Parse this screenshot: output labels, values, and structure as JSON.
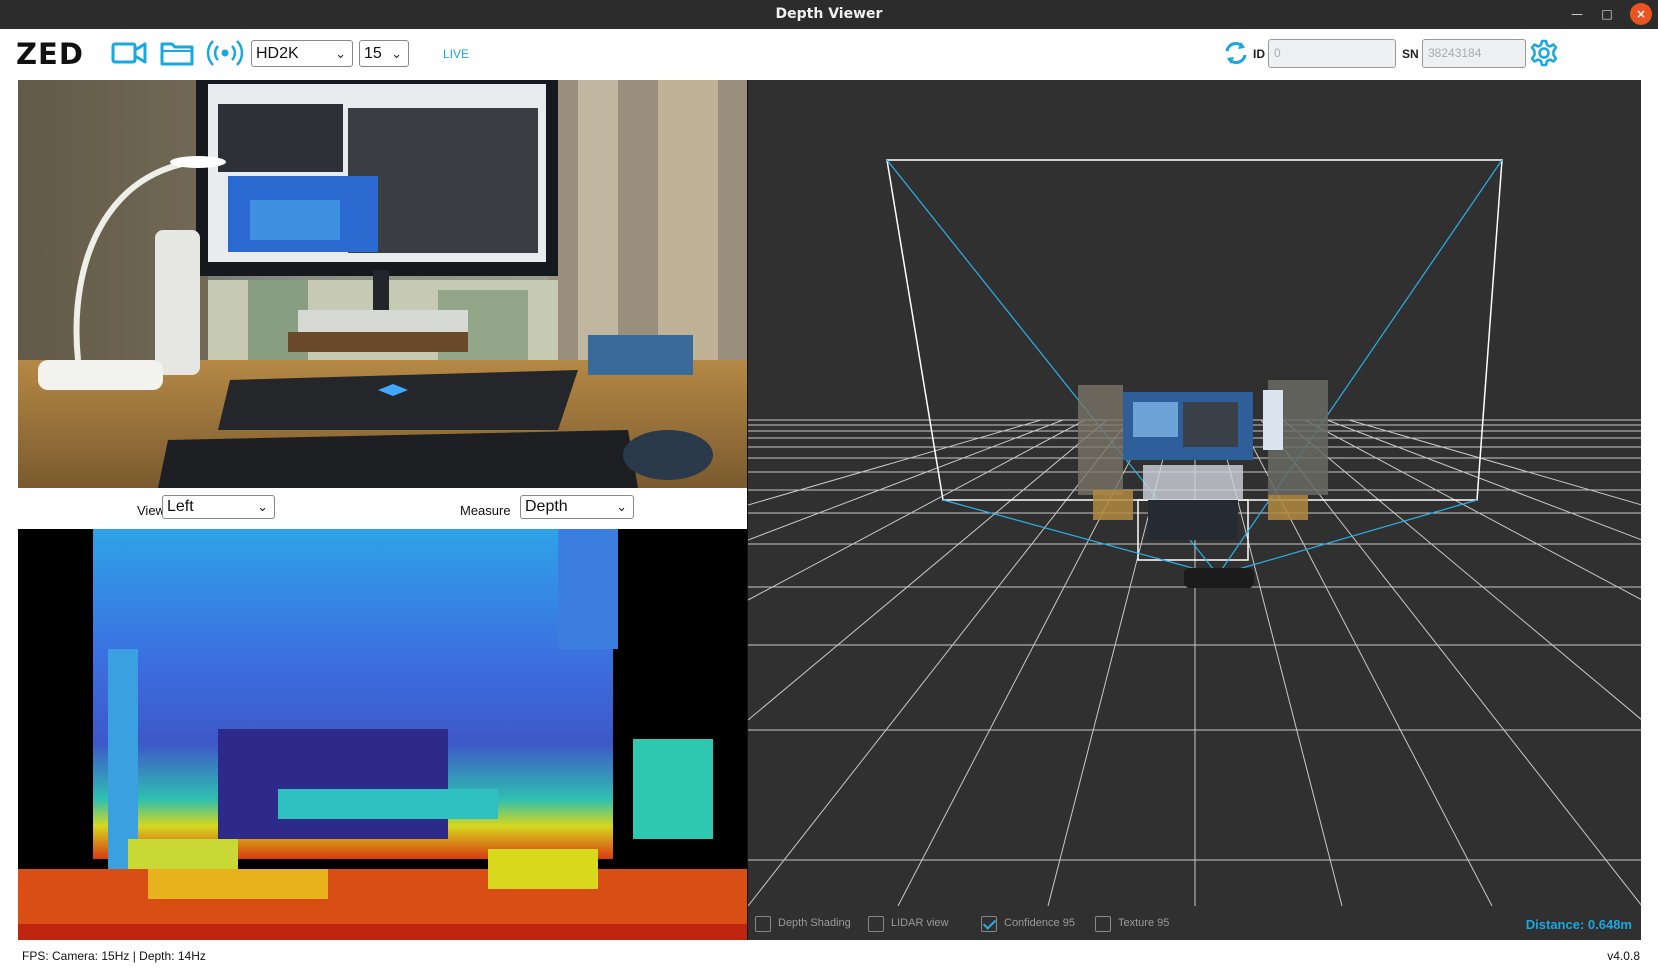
{
  "window": {
    "title": "Depth Viewer"
  },
  "toolbar": {
    "logo": "ZED",
    "resolution": "HD2K",
    "fps": "15",
    "live_label": "LIVE",
    "id_label": "ID",
    "id_placeholder": "0",
    "sn_label": "SN",
    "sn_placeholder": "38243184",
    "accent": "#19a7e0"
  },
  "controls": {
    "view_label": "View",
    "view_value": "Left",
    "measure_label": "Measure",
    "measure_value": "Depth"
  },
  "viewer3d": {
    "options": [
      {
        "label": "Depth Shading",
        "checked": false
      },
      {
        "label": "LIDAR view",
        "checked": false
      },
      {
        "label": "Confidence 95",
        "checked": true
      },
      {
        "label": "Texture 95",
        "checked": false
      }
    ],
    "distance": "Distance: 0.648m"
  },
  "status": {
    "fps_text": "FPS: Camera: 15Hz | Depth: 14Hz",
    "version": "v4.0.8"
  },
  "icons": {
    "camera": "video-camera-icon",
    "folder": "folder-icon",
    "stream": "broadcast-icon",
    "refresh": "refresh-icon",
    "settings": "gear-icon"
  }
}
